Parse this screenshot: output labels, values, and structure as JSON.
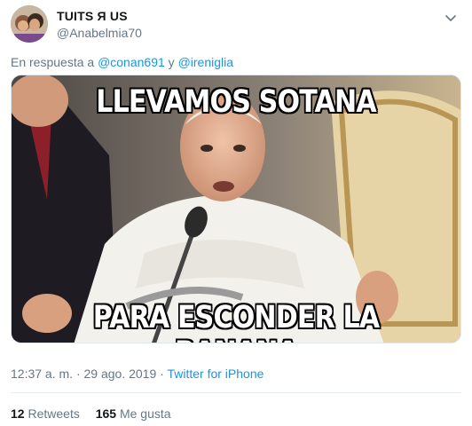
{
  "tweet": {
    "display_name": "TUITS Я US",
    "handle": "@Anabelmia70",
    "reply": {
      "prefix": "En respuesta a",
      "mention1": "@conan691",
      "joiner": "y",
      "mention2": "@irenigl​ia"
    },
    "meme": {
      "top_text": "LLEVAMOS SOTANA",
      "bottom_text": "PARA ESCONDER LA BANANA"
    },
    "time": "12:37 a. m.",
    "separator": "·",
    "date": "29 ago. 2019",
    "source": "Twitter for iPhone",
    "stats": {
      "retweets_count": "12",
      "retweets_label": "Retweets",
      "likes_count": "165",
      "likes_label": "Me gusta"
    }
  },
  "icons": {
    "chevron": "chevron-down-icon",
    "avatar": "avatar"
  },
  "colors": {
    "link": "#1b95e0",
    "muted": "#657786",
    "text": "#14171a"
  }
}
